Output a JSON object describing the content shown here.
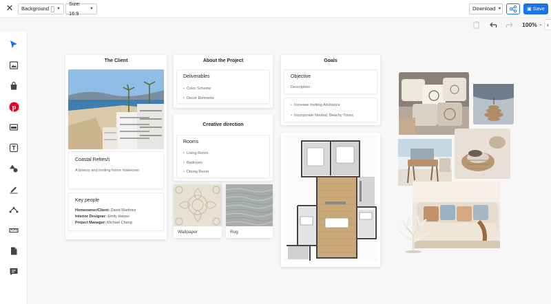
{
  "toolbar": {
    "background_label": "Background",
    "size_label": "Size: 16:9",
    "download_label": "Download",
    "save_label": "Save",
    "zoom": "100%"
  },
  "colors": {
    "accent": "#1a73e8",
    "pinterest": "#e60023",
    "select_arrow": "#1a73e8"
  },
  "tools": [
    "cursor-icon",
    "image-icon",
    "shopping-bag-icon",
    "pinterest-icon",
    "layout-icon",
    "text-icon",
    "shapes-icon",
    "pen-icon",
    "path-icon",
    "ruler-icon",
    "page-icon",
    "comment-icon"
  ],
  "client": {
    "title": "The Client",
    "project_name": "Coastal Refresh",
    "project_desc": "A breezy and inviting home makeover",
    "people_title": "Key people",
    "people": [
      {
        "role": "Homeowner/Client:",
        "name": "David Martinez"
      },
      {
        "role": "Interior Designer:",
        "name": "Emily Harper"
      },
      {
        "role": "Project Manager:",
        "name": "Michael Chang"
      }
    ]
  },
  "about": {
    "title": "About the Project",
    "deliverables_title": "Deliverables",
    "deliverables": [
      "Color Scheme",
      "Decor Elements"
    ]
  },
  "creative": {
    "title": "Creative direction",
    "rooms_title": "Rooms",
    "rooms": [
      "Living Room",
      "Bedroom",
      "Dining Room"
    ]
  },
  "materials": {
    "wallpaper": "Wallpaper",
    "rug": "Rug"
  },
  "goals": {
    "title": "Goals",
    "objective_title": "Objective",
    "objective_desc": "Description",
    "items": [
      "Increase Inviting Ambiance",
      "Incorporate Neutral, Beachy Tones"
    ]
  }
}
